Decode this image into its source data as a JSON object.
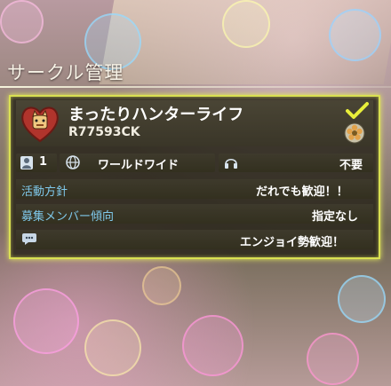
{
  "screen_title": "サークル管理",
  "circle": {
    "name": "まったりハンターライフ",
    "id": "R77593CK",
    "selected": true
  },
  "info": {
    "member_count": "1",
    "region": "ワールドワイド",
    "voice_chat": "不要"
  },
  "rows": [
    {
      "label": "活動方針",
      "value": "だれでも歓迎！！"
    },
    {
      "label": "募集メンバー傾向",
      "value": "指定なし"
    },
    {
      "label": "",
      "value": "エンジョイ勢歓迎！"
    }
  ],
  "icons": {
    "emblem": "cat-heart-emblem-icon",
    "check": "checkmark-icon",
    "rank": "flower-badge-icon",
    "members": "person-icon",
    "region": "globe-icon",
    "voice": "headset-icon",
    "comment": "chat-bubble-icon"
  },
  "colors": {
    "highlight": "#d9e052",
    "label": "#7fc8ea"
  }
}
